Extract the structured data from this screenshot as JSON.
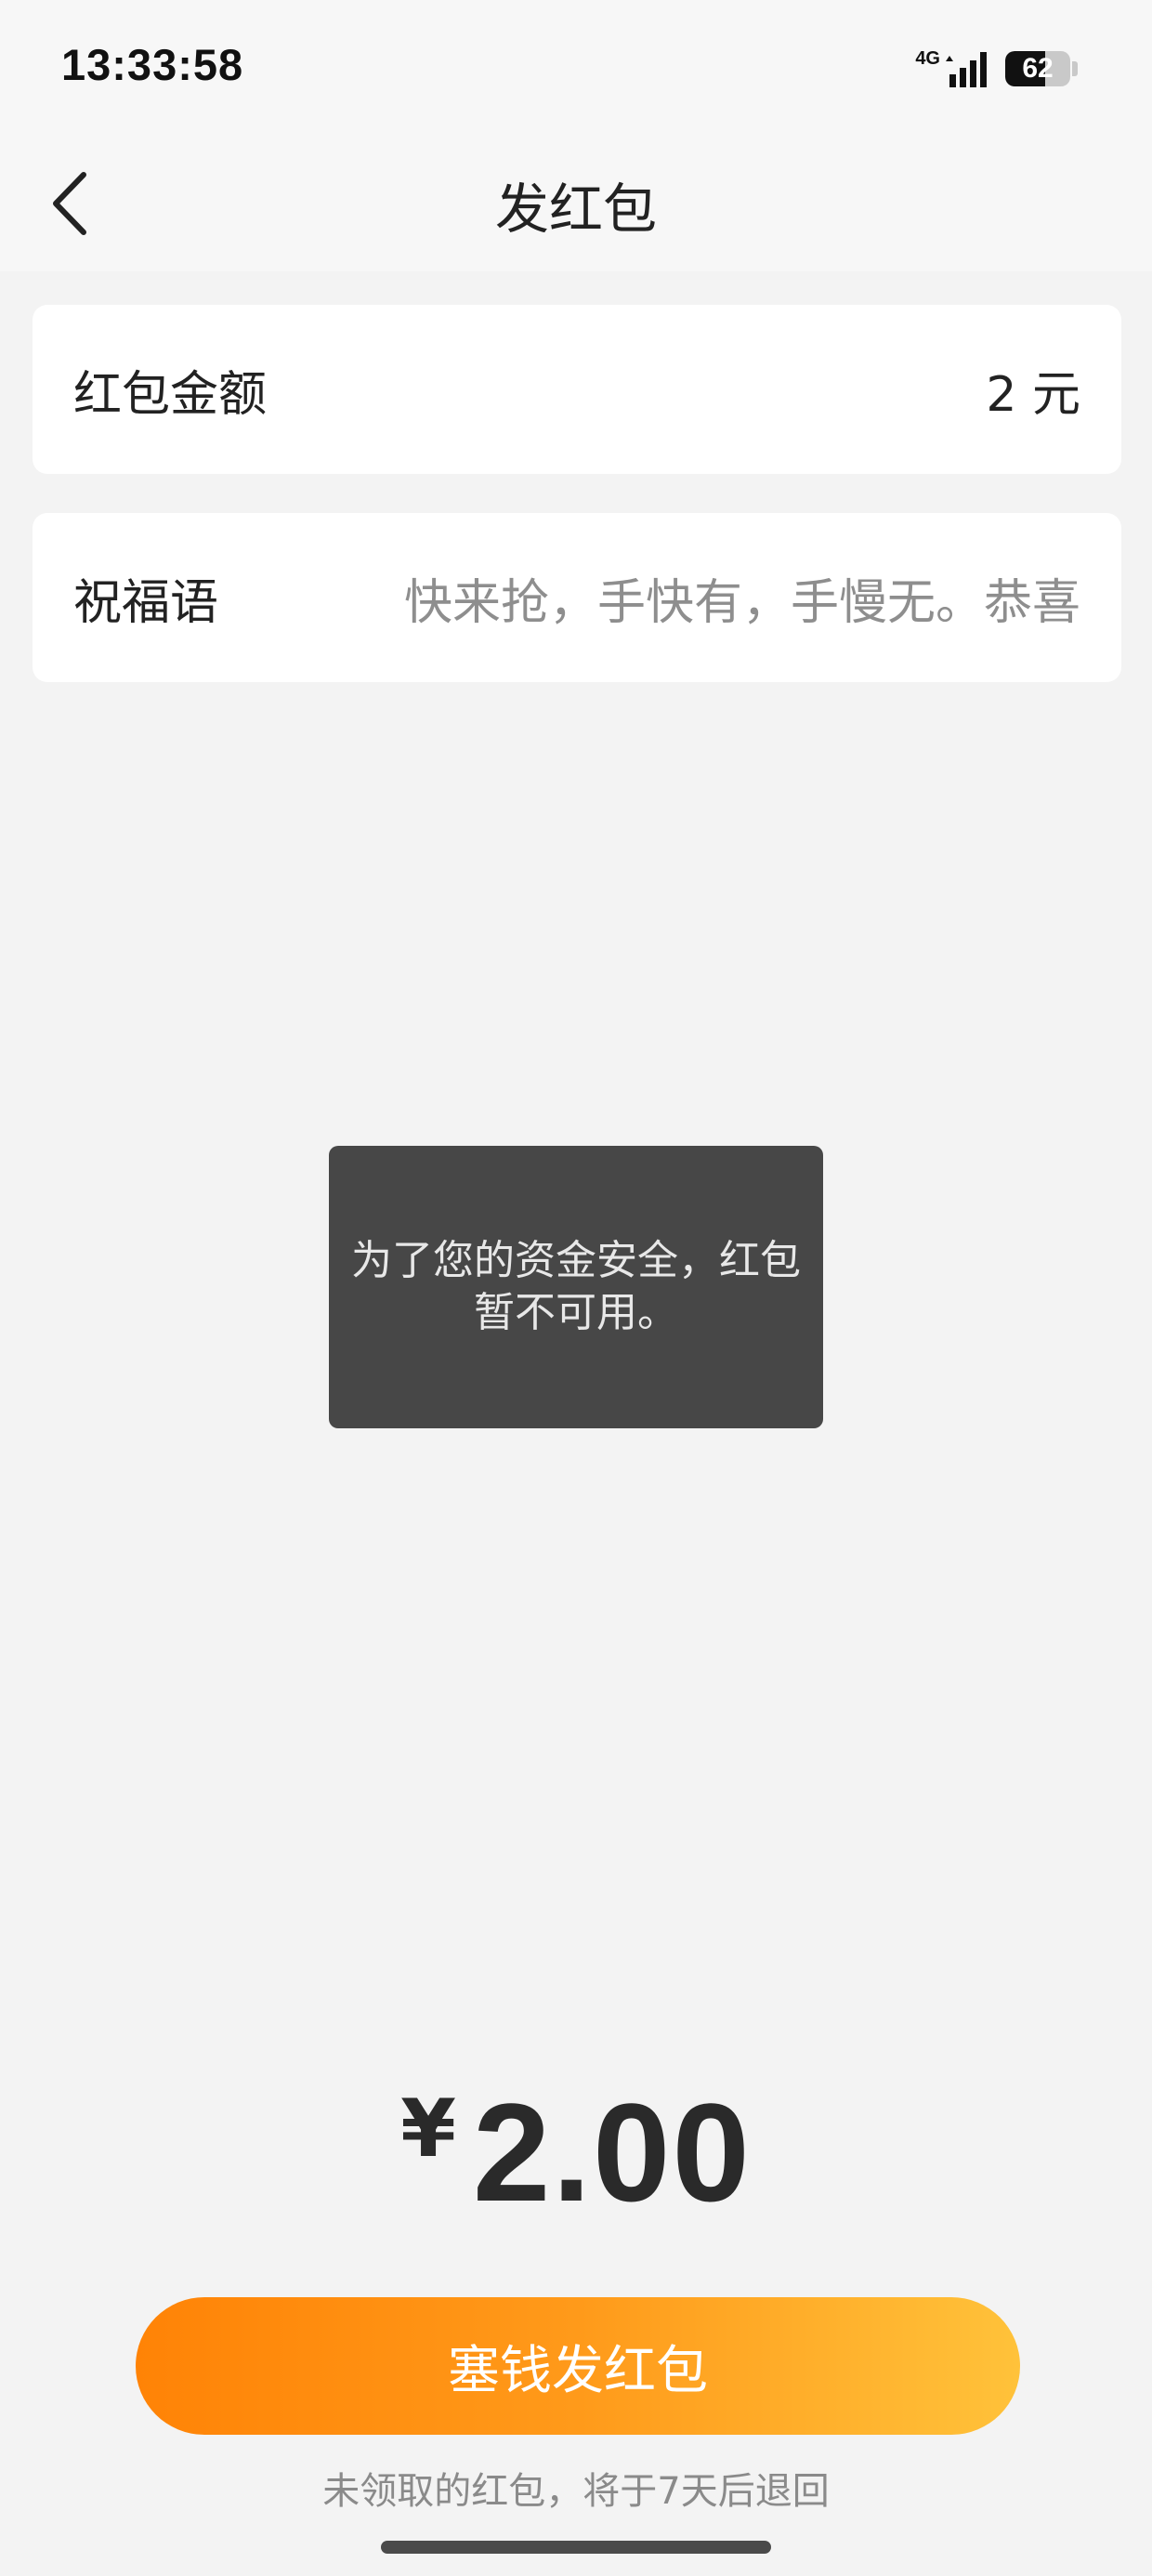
{
  "status_bar": {
    "time": "13:33:58",
    "network": "4G",
    "battery_level": "62",
    "battery_fraction": 0.62
  },
  "nav": {
    "title": "发红包",
    "back_icon": "chevron-left-icon"
  },
  "form": {
    "amount_label": "红包金额",
    "amount_value": "2 元",
    "blessing_label": "祝福语",
    "blessing_placeholder": "快来抢，手快有，手慢无。恭喜"
  },
  "toast": {
    "message": "为了您的资金安全，红包暂不可用。"
  },
  "total": {
    "currency": "¥",
    "value": "2.00"
  },
  "send_button": {
    "label": "塞钱发红包"
  },
  "hint": "未领取的红包，将于7天后退回",
  "colors": {
    "button_start": "#ff8306",
    "button_end": "#ffc23a",
    "background": "#f3f3f3",
    "toast_bg": "#474747"
  }
}
